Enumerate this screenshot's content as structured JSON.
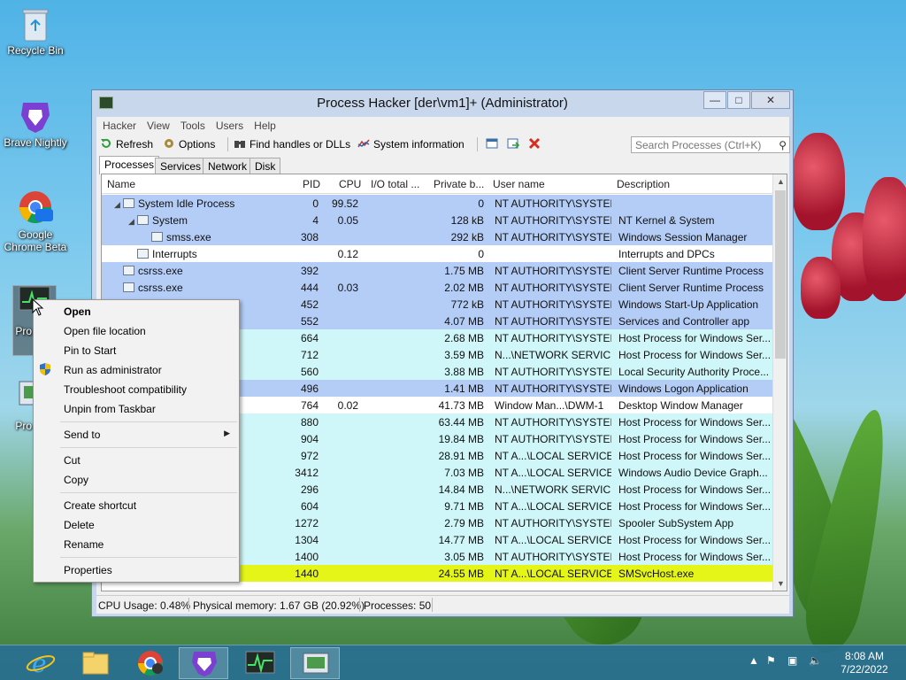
{
  "desktop": {
    "icons": [
      {
        "label": "Recycle Bin"
      },
      {
        "label": "Brave Nightly",
        "badge": "nightly"
      },
      {
        "label": "Google Chrome Beta",
        "badge": "Beta"
      },
      {
        "label": "Pro Hac"
      },
      {
        "label": "Pro Hac"
      }
    ]
  },
  "window": {
    "title": "Process Hacker [der\\vm1]+ (Administrator)",
    "menu": [
      "Hacker",
      "View",
      "Tools",
      "Users",
      "Help"
    ],
    "toolbar": {
      "refresh": "Refresh",
      "options": "Options",
      "find_handles": "Find handles or DLLs",
      "system_info": "System information",
      "search_placeholder": "Search Processes (Ctrl+K)"
    },
    "tabs": [
      "Processes",
      "Services",
      "Network",
      "Disk"
    ],
    "columns": [
      "Name",
      "PID",
      "CPU",
      "I/O total ...",
      "Private b...",
      "User name",
      "Description"
    ],
    "rows": [
      {
        "indent": 0,
        "tri": "◢",
        "name": "System Idle Process",
        "pid": "0",
        "cpu": "99.52",
        "io": "",
        "priv": "0",
        "user": "NT AUTHORITY\\SYSTEM",
        "desc": "",
        "bg": "#b4cdf7"
      },
      {
        "indent": 1,
        "tri": "◢",
        "name": "System",
        "pid": "4",
        "cpu": "0.05",
        "io": "",
        "priv": "128 kB",
        "user": "NT AUTHORITY\\SYSTEM",
        "desc": "NT Kernel & System",
        "bg": "#b4cdf7"
      },
      {
        "indent": 2,
        "tri": "",
        "name": "smss.exe",
        "pid": "308",
        "cpu": "",
        "io": "",
        "priv": "292 kB",
        "user": "NT AUTHORITY\\SYSTEM",
        "desc": "Windows Session Manager",
        "bg": "#b4cdf7"
      },
      {
        "indent": 1,
        "tri": "",
        "name": "Interrupts",
        "pid": "",
        "cpu": "0.12",
        "io": "",
        "priv": "0",
        "user": "",
        "desc": "Interrupts and DPCs",
        "bg": "#ffffff"
      },
      {
        "indent": 0,
        "tri": "",
        "name": "csrss.exe",
        "pid": "392",
        "cpu": "",
        "io": "",
        "priv": "1.75 MB",
        "user": "NT AUTHORITY\\SYSTEM",
        "desc": "Client Server Runtime Process",
        "bg": "#b4cdf7"
      },
      {
        "indent": 0,
        "tri": "",
        "name": "csrss.exe",
        "pid": "444",
        "cpu": "0.03",
        "io": "",
        "priv": "2.02 MB",
        "user": "NT AUTHORITY\\SYSTEM",
        "desc": "Client Server Runtime Process",
        "bg": "#b4cdf7"
      },
      {
        "indent": 0,
        "tri": "",
        "name": "",
        "pid": "452",
        "cpu": "",
        "io": "",
        "priv": "772 kB",
        "user": "NT AUTHORITY\\SYSTEM",
        "desc": "Windows Start-Up Application",
        "bg": "#b4cdf7"
      },
      {
        "indent": 0,
        "tri": "",
        "name": "",
        "pid": "552",
        "cpu": "",
        "io": "",
        "priv": "4.07 MB",
        "user": "NT AUTHORITY\\SYSTEM",
        "desc": "Services and Controller app",
        "bg": "#b4cdf7"
      },
      {
        "indent": 0,
        "tri": "",
        "name": "",
        "pid": "664",
        "cpu": "",
        "io": "",
        "priv": "2.68 MB",
        "user": "NT AUTHORITY\\SYSTEM",
        "desc": "Host Process for Windows Ser...",
        "bg": "#cff6f8"
      },
      {
        "indent": 0,
        "tri": "",
        "name": "",
        "pid": "712",
        "cpu": "",
        "io": "",
        "priv": "3.59 MB",
        "user": "N...\\NETWORK SERVICE",
        "desc": "Host Process for Windows Ser...",
        "bg": "#cff6f8"
      },
      {
        "indent": 0,
        "tri": "",
        "name": "",
        "pid": "560",
        "cpu": "",
        "io": "",
        "priv": "3.88 MB",
        "user": "NT AUTHORITY\\SYSTEM",
        "desc": "Local Security Authority Proce...",
        "bg": "#cff6f8"
      },
      {
        "indent": 0,
        "tri": "",
        "name": "",
        "pid": "496",
        "cpu": "",
        "io": "",
        "priv": "1.41 MB",
        "user": "NT AUTHORITY\\SYSTEM",
        "desc": "Windows Logon Application",
        "bg": "#b4cdf7"
      },
      {
        "indent": 0,
        "tri": "",
        "name": "",
        "pid": "764",
        "cpu": "0.02",
        "io": "",
        "priv": "41.73 MB",
        "user": "Window Man...\\DWM-1",
        "desc": "Desktop Window Manager",
        "bg": "#ffffff"
      },
      {
        "indent": 0,
        "tri": "",
        "name": "",
        "pid": "880",
        "cpu": "",
        "io": "",
        "priv": "63.44 MB",
        "user": "NT AUTHORITY\\SYSTEM",
        "desc": "Host Process for Windows Ser...",
        "bg": "#cff6f8"
      },
      {
        "indent": 0,
        "tri": "",
        "name": "",
        "pid": "904",
        "cpu": "",
        "io": "",
        "priv": "19.84 MB",
        "user": "NT AUTHORITY\\SYSTEM",
        "desc": "Host Process for Windows Ser...",
        "bg": "#cff6f8"
      },
      {
        "indent": 0,
        "tri": "",
        "name": "",
        "pid": "972",
        "cpu": "",
        "io": "",
        "priv": "28.91 MB",
        "user": "NT A...\\LOCAL SERVICE",
        "desc": "Host Process for Windows Ser...",
        "bg": "#cff6f8"
      },
      {
        "indent": 0,
        "tri": "",
        "name": "",
        "pid": "3412",
        "cpu": "",
        "io": "",
        "priv": "7.03 MB",
        "user": "NT A...\\LOCAL SERVICE",
        "desc": "Windows Audio Device Graph...",
        "bg": "#cff6f8"
      },
      {
        "indent": 0,
        "tri": "",
        "name": "",
        "pid": "296",
        "cpu": "",
        "io": "",
        "priv": "14.84 MB",
        "user": "N...\\NETWORK SERVICE",
        "desc": "Host Process for Windows Ser...",
        "bg": "#cff6f8"
      },
      {
        "indent": 0,
        "tri": "",
        "name": "",
        "pid": "604",
        "cpu": "",
        "io": "",
        "priv": "9.71 MB",
        "user": "NT A...\\LOCAL SERVICE",
        "desc": "Host Process for Windows Ser...",
        "bg": "#cff6f8"
      },
      {
        "indent": 0,
        "tri": "",
        "name": "",
        "pid": "1272",
        "cpu": "",
        "io": "",
        "priv": "2.79 MB",
        "user": "NT AUTHORITY\\SYSTEM",
        "desc": "Spooler SubSystem App",
        "bg": "#cff6f8"
      },
      {
        "indent": 0,
        "tri": "",
        "name": "",
        "pid": "1304",
        "cpu": "",
        "io": "",
        "priv": "14.77 MB",
        "user": "NT A...\\LOCAL SERVICE",
        "desc": "Host Process for Windows Ser...",
        "bg": "#cff6f8"
      },
      {
        "indent": 0,
        "tri": "",
        "name": "",
        "pid": "1400",
        "cpu": "",
        "io": "",
        "priv": "3.05 MB",
        "user": "NT AUTHORITY\\SYSTEM",
        "desc": "Host Process for Windows Ser...",
        "bg": "#cff6f8"
      },
      {
        "indent": 0,
        "tri": "",
        "name": "",
        "pid": "1440",
        "cpu": "",
        "io": "",
        "priv": "24.55 MB",
        "user": "NT A...\\LOCAL SERVICE",
        "desc": "SMSvcHost.exe",
        "bg": "#e6f518"
      }
    ],
    "status": {
      "cpu": "CPU Usage: 0.48%",
      "memory": "Physical memory: 1.67 GB (20.92%)",
      "processes": "Processes: 50"
    }
  },
  "context_menu": {
    "items": [
      "Open",
      "Open file location",
      "Pin to Start",
      "Run as administrator",
      "Troubleshoot compatibility",
      "Unpin from Taskbar",
      "Send to",
      "Cut",
      "Copy",
      "Create shortcut",
      "Delete",
      "Rename",
      "Properties"
    ]
  },
  "taskbar": {
    "time": "8:08 AM",
    "date": "7/22/2022"
  },
  "colors": {
    "row_system": "#b4cdf7",
    "row_service": "#cff6f8",
    "row_highlight": "#e6f518"
  }
}
